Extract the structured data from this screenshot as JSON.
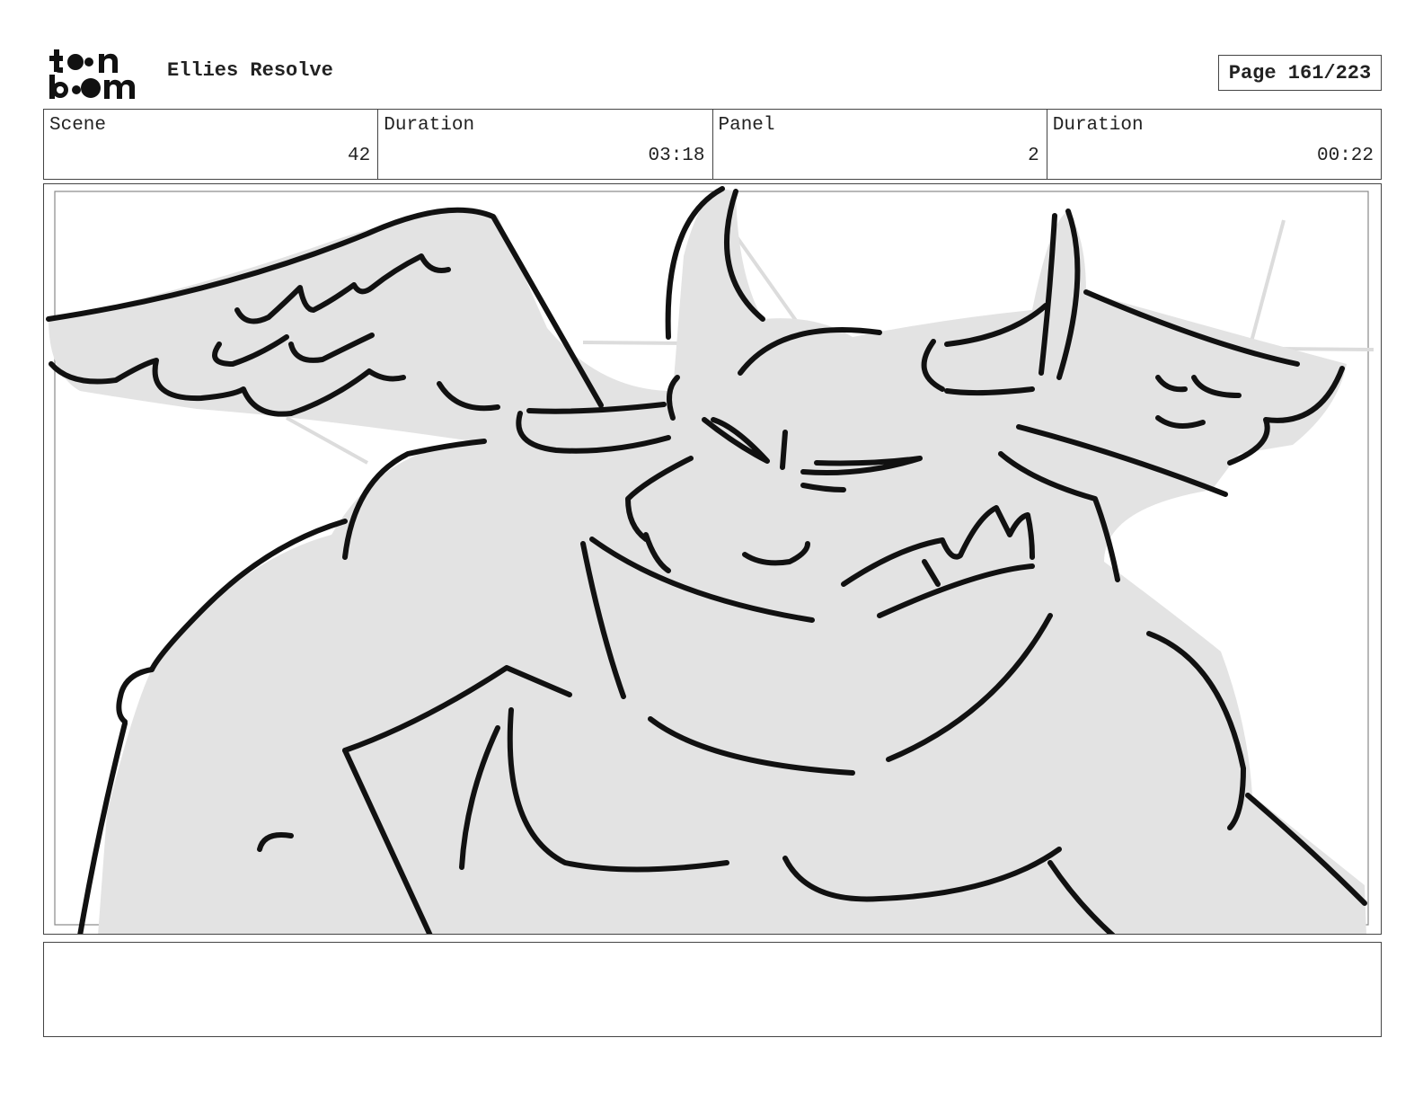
{
  "header": {
    "logo_text": "toon boom",
    "title": "Ellies Resolve",
    "page_label": "Page 161/223"
  },
  "info": {
    "scene_label": "Scene",
    "scene_value": "42",
    "scene_duration_label": "Duration",
    "scene_duration_value": "03:18",
    "panel_label": "Panel",
    "panel_value": "2",
    "panel_duration_label": "Duration",
    "panel_duration_value": "00:22"
  },
  "notes": {
    "text": ""
  },
  "colors": {
    "fill_gray": "#e3e3e3",
    "line": "#111111",
    "guide": "#dcdcdc"
  }
}
